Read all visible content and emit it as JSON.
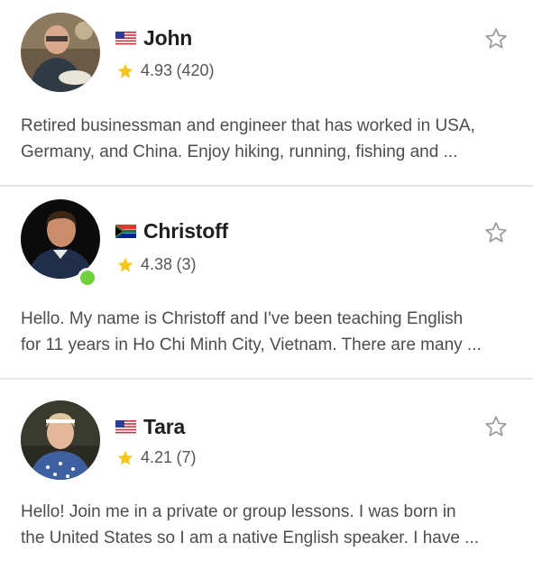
{
  "teachers": [
    {
      "name": "John",
      "flag": "us-flag-icon",
      "rating": "4.93",
      "reviews": "(420)",
      "online": false,
      "bio_lines": [
        "Retired businessman and engineer that has worked in USA,",
        "Germany, and China. Enjoy hiking, running, fishing and ..."
      ]
    },
    {
      "name": "Christoff",
      "flag": "south-africa-flag-icon",
      "rating": "4.38",
      "reviews": "(3)",
      "online": true,
      "bio_lines": [
        "Hello. My name is Christoff and I've been teaching English",
        "for 11 years in Ho Chi Minh City, Vietnam. There are many ..."
      ]
    },
    {
      "name": "Tara",
      "flag": "us-flag-icon",
      "rating": "4.21",
      "reviews": "(7)",
      "online": false,
      "bio_lines": [
        "Hello!  Join me in a private or group lessons. I was born in",
        "the United States so I am a native English speaker. I have ..."
      ]
    }
  ],
  "colors": {
    "star_rating": "#f7c61a",
    "star_outline": "#9a9a9a",
    "online": "#6fd23b",
    "separator": "#e7e7e7"
  }
}
